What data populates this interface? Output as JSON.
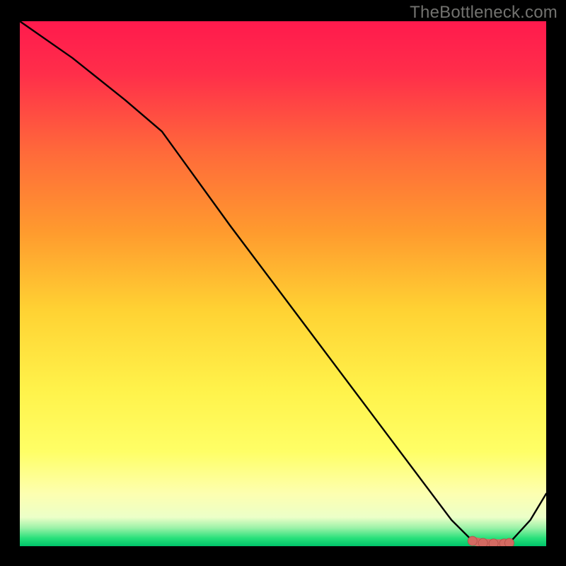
{
  "watermark": "TheBottleneck.com",
  "colors": {
    "background": "#000000",
    "watermark_text": "#72726f",
    "curve": "#000000",
    "marker_fill": "#d46a62",
    "marker_stroke": "#b7544d",
    "gradient_stops": [
      {
        "offset": 0.0,
        "color": "#ff1a4d"
      },
      {
        "offset": 0.1,
        "color": "#ff2e4a"
      },
      {
        "offset": 0.25,
        "color": "#ff6a3a"
      },
      {
        "offset": 0.4,
        "color": "#ff9a2e"
      },
      {
        "offset": 0.55,
        "color": "#ffd233"
      },
      {
        "offset": 0.7,
        "color": "#fff24a"
      },
      {
        "offset": 0.82,
        "color": "#ffff66"
      },
      {
        "offset": 0.9,
        "color": "#fdffb0"
      },
      {
        "offset": 0.945,
        "color": "#ecffc8"
      },
      {
        "offset": 0.965,
        "color": "#9cf2a8"
      },
      {
        "offset": 0.985,
        "color": "#26e07a"
      },
      {
        "offset": 1.0,
        "color": "#00c46a"
      }
    ]
  },
  "chart_data": {
    "type": "line",
    "title": "",
    "xlabel": "",
    "ylabel": "",
    "xlim": [
      0,
      100
    ],
    "ylim": [
      0,
      100
    ],
    "grid": false,
    "series": [
      {
        "name": "bottleneck-curve",
        "x": [
          0,
          10,
          20,
          27,
          40,
          55,
          70,
          82,
          86,
          88,
          90,
          92,
          93,
          97,
          100
        ],
        "y": [
          100,
          93,
          85,
          79,
          61,
          41,
          21,
          5,
          1,
          0.6,
          0.5,
          0.5,
          0.6,
          5,
          10
        ]
      }
    ],
    "highlight_region": {
      "name": "sweet-spot",
      "x": [
        86,
        88,
        90,
        92,
        93
      ],
      "y": [
        1.0,
        0.6,
        0.5,
        0.5,
        0.6
      ]
    }
  }
}
